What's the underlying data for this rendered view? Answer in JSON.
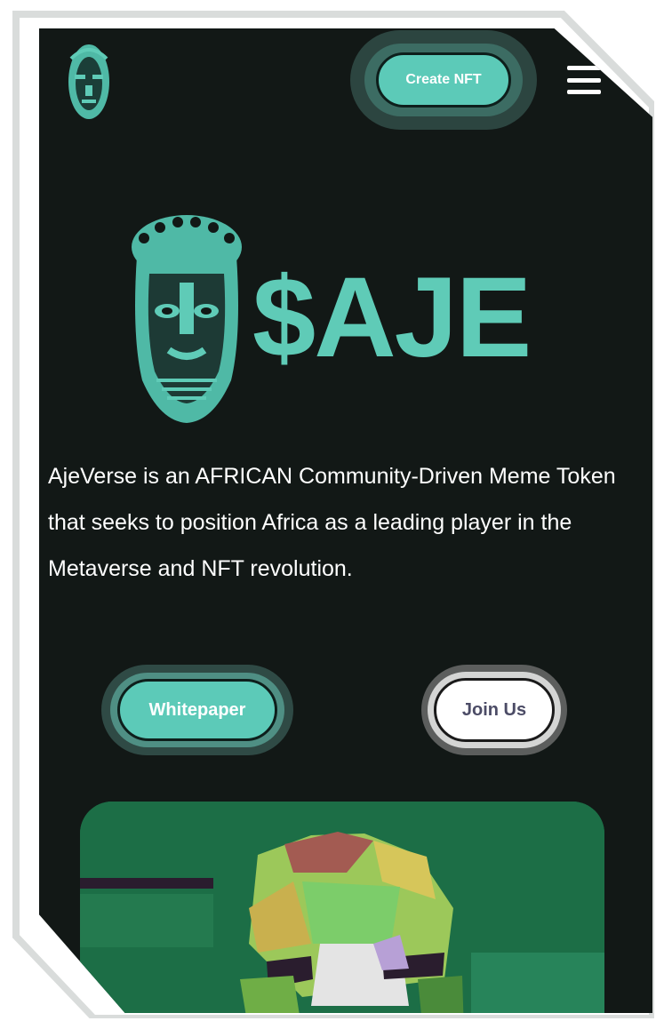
{
  "header": {
    "create_nft_label": "Create NFT"
  },
  "hero": {
    "brand": "$AJE",
    "description": "AjeVerse is an AFRICAN Community-Driven Meme Token that seeks to position Africa as a leading player in the Metaverse and NFT revolution."
  },
  "actions": {
    "whitepaper_label": "Whitepaper",
    "join_label": "Join Us"
  },
  "icons": {
    "logo": "mask-logo-icon",
    "menu": "hamburger-menu-icon"
  },
  "colors": {
    "background": "#121816",
    "accent": "#5ccab8",
    "brand_text": "#5fcbb7",
    "card": "#1c6e46"
  }
}
